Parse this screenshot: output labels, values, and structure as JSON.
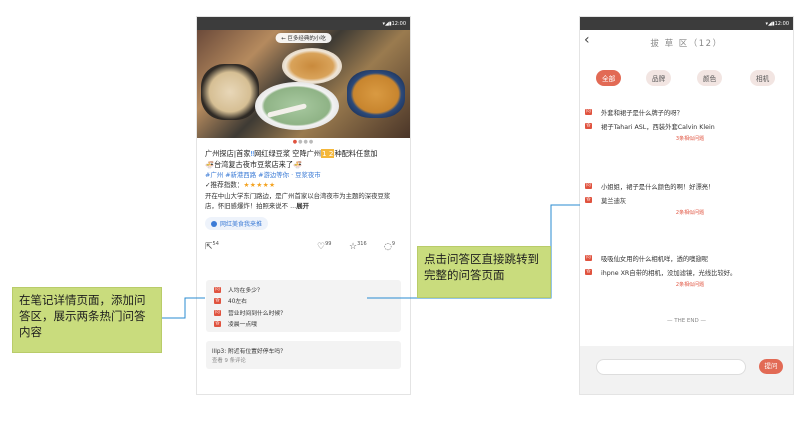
{
  "left_phone": {
    "status_time": "▾◢▮12:00",
    "photo_pill": "← 巨多经典的小吃",
    "post": {
      "title_part1": "广州探店|首家",
      "title_mid": "网红绿豆浆 空降广州",
      "title_num": "1 2",
      "title_part2": "种配料任意加",
      "title_line2": "🍜台湾复古夜市豆浆店来了🍜",
      "tags": "#广州 #新港西路 #游边等你 · 豆浆夜市",
      "rating_label": "✓推荐指数：",
      "rating_stars": "★★★★★",
      "rating_value": 5,
      "desc": "开在中山大学东门路边，是广州首家以台湾夜市为主题的深夜豆浆店，怀旧感爆炸！拍照来说不 ...",
      "desc_more": "展开",
      "topic": "网红美食我来推"
    },
    "actions": {
      "share_count": "54",
      "like_count": "99",
      "star_count": "316",
      "comment_count": "9"
    },
    "qa": [
      {
        "badge": "问",
        "text": "人均在多少？"
      },
      {
        "badge": "答",
        "text": "40左右"
      },
      {
        "badge": "问",
        "text": "营业时间到什么时候？"
      },
      {
        "badge": "答",
        "text": "凌晨一点哦"
      }
    ],
    "comment": {
      "text": "lllp3: 附近有位置好停车吗？",
      "sub": "查看 9 条评论"
    }
  },
  "right_phone": {
    "status_time": "▾◢▮12:00",
    "title": "拔 草 区（12）",
    "tabs": [
      "全部",
      "品牌",
      "颜色",
      "相机"
    ],
    "active_tab": "全部",
    "questions": [
      {
        "q": "外套和裙子是什么牌子的呀？",
        "a": "裙子Tahari ASL，西装外套Calvin Klein",
        "more": "3条相似问题"
      },
      {
        "q": "小姐姐，裙子是什么颜色的啊！好漂亮！",
        "a": "莫兰迪灰",
        "more": "2条相似问题"
      },
      {
        "q": "吸吸仙女用的什么相机咩，透的噢翅呢",
        "a": "ihpne XR自带的相机，没加滤镜，光线比较好。",
        "more": "2条相似问题"
      }
    ],
    "end_text": "— THE END —",
    "ask_placeholder": "",
    "ask_button": "提问"
  },
  "annotations": {
    "left": "在笔记详情页面，添加问答区，展示两条热门问答内容",
    "right": "点击问答区直接跳转到完整的问答页面"
  },
  "colors": {
    "accent": "#e26a55",
    "callout": "#c9dc7d",
    "link": "#3b7bd6",
    "connector": "#2a8bd0"
  }
}
